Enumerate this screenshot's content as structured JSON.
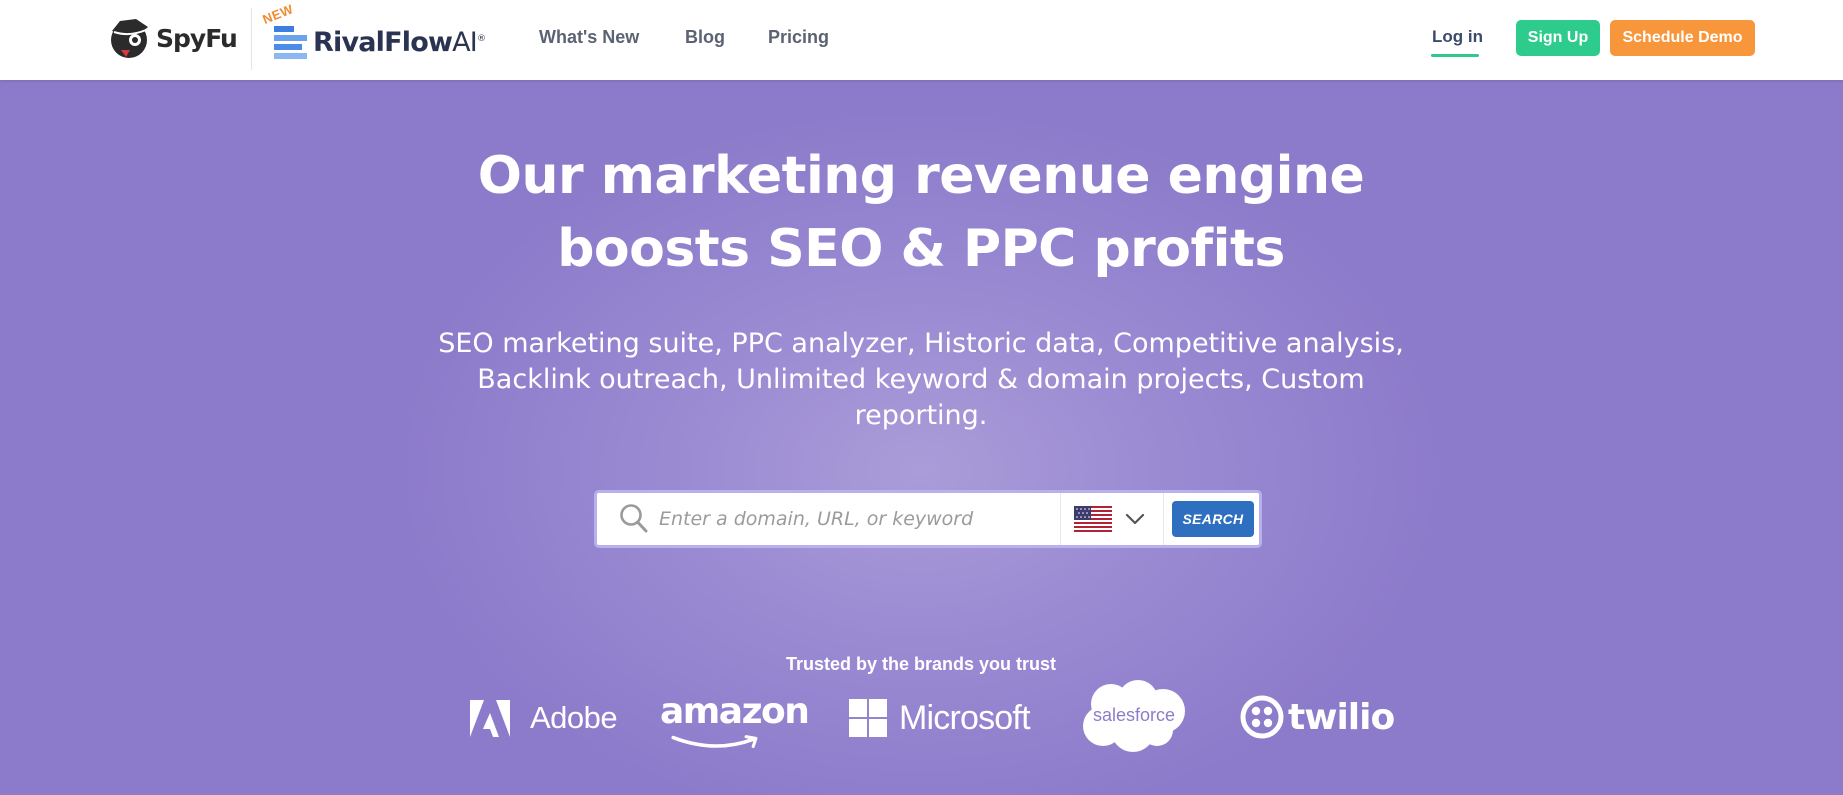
{
  "nav": {
    "spyfu_logo": "SpyFu",
    "rival_badge": "NEW",
    "rival_logo_main": "RivalFlow",
    "rival_logo_ai": "AI",
    "rival_logo_reg": "®",
    "links": [
      {
        "label": "What's New"
      },
      {
        "label": "Blog"
      },
      {
        "label": "Pricing"
      }
    ],
    "login_label": "Log in",
    "signup_label": "Sign Up",
    "demo_label": "Schedule Demo",
    "colors": {
      "signup": "#2ecc8c",
      "demo": "#f7963b",
      "login_underline": "#2fc98f"
    }
  },
  "hero": {
    "title_line1": "Our marketing revenue engine",
    "title_line2": "boosts SEO & PPC profits",
    "subtitle_line1": "SEO marketing suite, PPC analyzer, Historic data, Competitive analysis,",
    "subtitle_line2": "Backlink outreach, Unlimited keyword & domain projects, Custom",
    "subtitle_line3": "reporting.",
    "background": "#8f7fcc"
  },
  "search": {
    "placeholder": "Enter a domain, URL, or keyword",
    "value": "",
    "country_icon": "us-flag-icon",
    "button_label": "SEARCH",
    "button_color": "#2f6fbf"
  },
  "trusted": {
    "heading": "Trusted by the brands you trust",
    "brands": [
      {
        "name": "Adobe",
        "icon": "adobe-logo-icon"
      },
      {
        "name": "amazon",
        "icon": "amazon-logo-icon"
      },
      {
        "name": "Microsoft",
        "icon": "microsoft-logo-icon"
      },
      {
        "name": "salesforce",
        "icon": "salesforce-logo-icon"
      },
      {
        "name": "twilio",
        "icon": "twilio-logo-icon"
      }
    ]
  }
}
